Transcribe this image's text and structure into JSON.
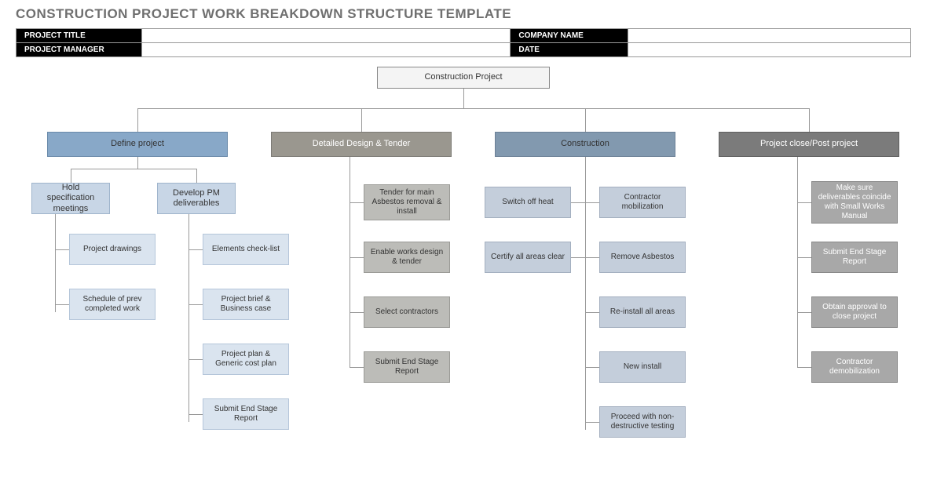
{
  "title": "CONSTRUCTION PROJECT WORK BREAKDOWN STRUCTURE TEMPLATE",
  "header": {
    "project_title_label": "PROJECT TITLE",
    "project_title_value": "",
    "company_name_label": "COMPANY NAME",
    "company_name_value": "",
    "project_manager_label": "PROJECT MANAGER",
    "project_manager_value": "",
    "date_label": "DATE",
    "date_value": ""
  },
  "root": "Construction Project",
  "phases": [
    "Define project",
    "Detailed Design & Tender",
    "Construction",
    "Project close/Post project"
  ],
  "define": {
    "sub1": "Hold specification meetings",
    "sub2": "Develop PM deliverables",
    "sub1_items": [
      "Project drawings",
      "Schedule of prev completed work"
    ],
    "sub2_items": [
      "Elements check-list",
      "Project brief & Business case",
      "Project plan & Generic cost plan",
      "Submit End Stage Report"
    ]
  },
  "design_items": [
    "Tender for main Asbestos removal & install",
    "Enable works design & tender",
    "Select contractors",
    "Submit End Stage Report"
  ],
  "construction": {
    "left": [
      "Switch off heat",
      "Certify all areas clear"
    ],
    "right": [
      "Contractor mobilization",
      "Remove Asbestos",
      "Re-install all areas",
      "New install",
      "Proceed with non-destructive testing"
    ]
  },
  "close_items": [
    "Make sure deliverables coincide with Small Works Manual",
    "Submit End Stage Report",
    "Obtain approval to close project",
    "Contractor demobilization"
  ]
}
